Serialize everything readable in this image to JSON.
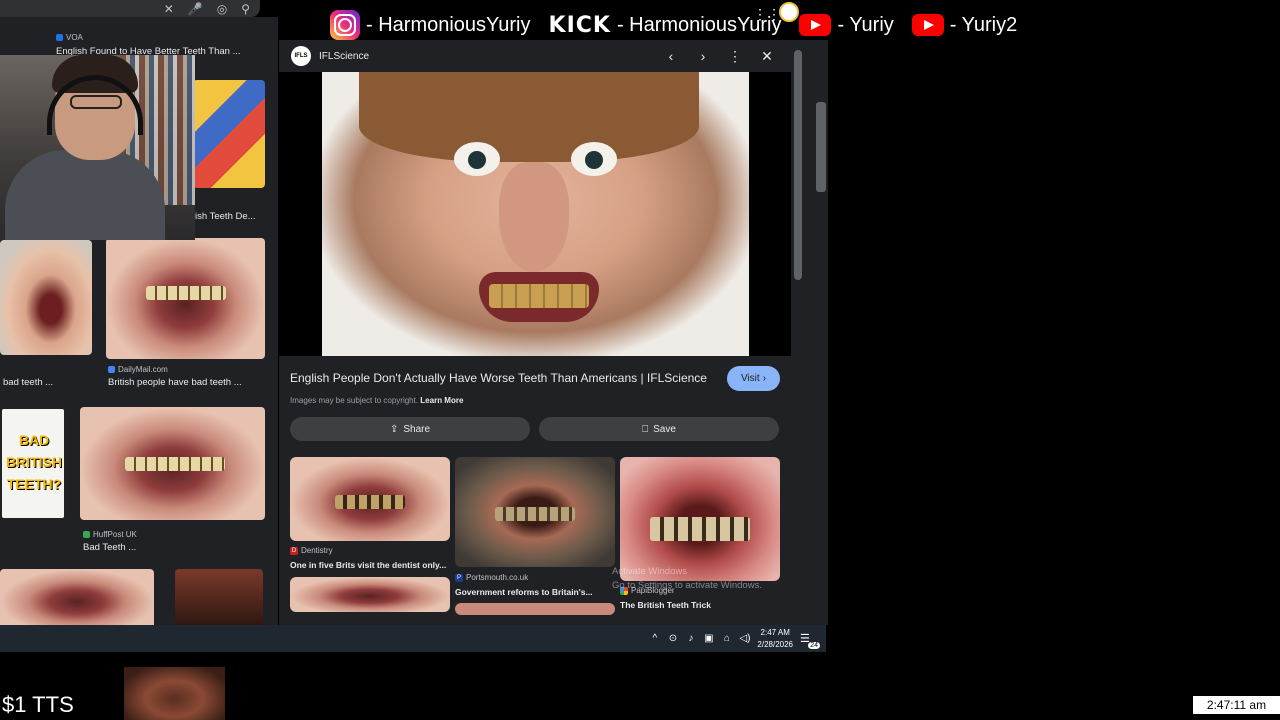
{
  "overlay": {
    "instagram": "- HarmoniousYuriy",
    "kick_logo": "KICK",
    "kick": "- HarmoniousYuriy",
    "youtube1": "- Yuriy",
    "youtube2": "- Yuriy2"
  },
  "left_grid": {
    "items": [
      {
        "source": "VOA",
        "title": "English Found to Have Better Teeth Than ..."
      },
      {
        "source": "",
        "title": "ish Teeth De..."
      },
      {
        "source": "",
        "title": "bad teeth ..."
      },
      {
        "source": "DailyMail.com",
        "title": "British people have bad teeth ..."
      },
      {
        "thumb_text": "BAD BRITISH TEETH?"
      },
      {
        "source": "HuffPost UK",
        "title": "Bad Teeth ..."
      }
    ]
  },
  "panel": {
    "site_logo": "IFLS",
    "site_name": "IFLScience",
    "title": "English People Don't Actually Have Worse Teeth Than Americans | IFLScience",
    "visit_label": "Visit",
    "copyright": "Images may be subject to copyright.",
    "learn_more": "Learn More",
    "share_label": "Share",
    "save_label": "Save",
    "related": [
      {
        "source": "Dentistry",
        "title": "One in five Brits visit the dentist only...",
        "color": "#c5221f",
        "fav": "D"
      },
      {
        "source": "Portsmouth.co.uk",
        "title": "Government reforms to Britain's...",
        "color": "#1a3b8f",
        "fav": "P"
      },
      {
        "source": "PapiBlogger",
        "title": "The British Teeth Trick",
        "color": "#34a853",
        "fav": ""
      }
    ]
  },
  "activate": {
    "line1": "Activate Windows",
    "line2": "Go to Settings to activate Windows."
  },
  "taskbar": {
    "time": "2:47 AM",
    "date": "2/28/2026",
    "notif_count": "24"
  },
  "stream": {
    "tts": "$1 TTS",
    "clock": "2:47:11 am"
  }
}
